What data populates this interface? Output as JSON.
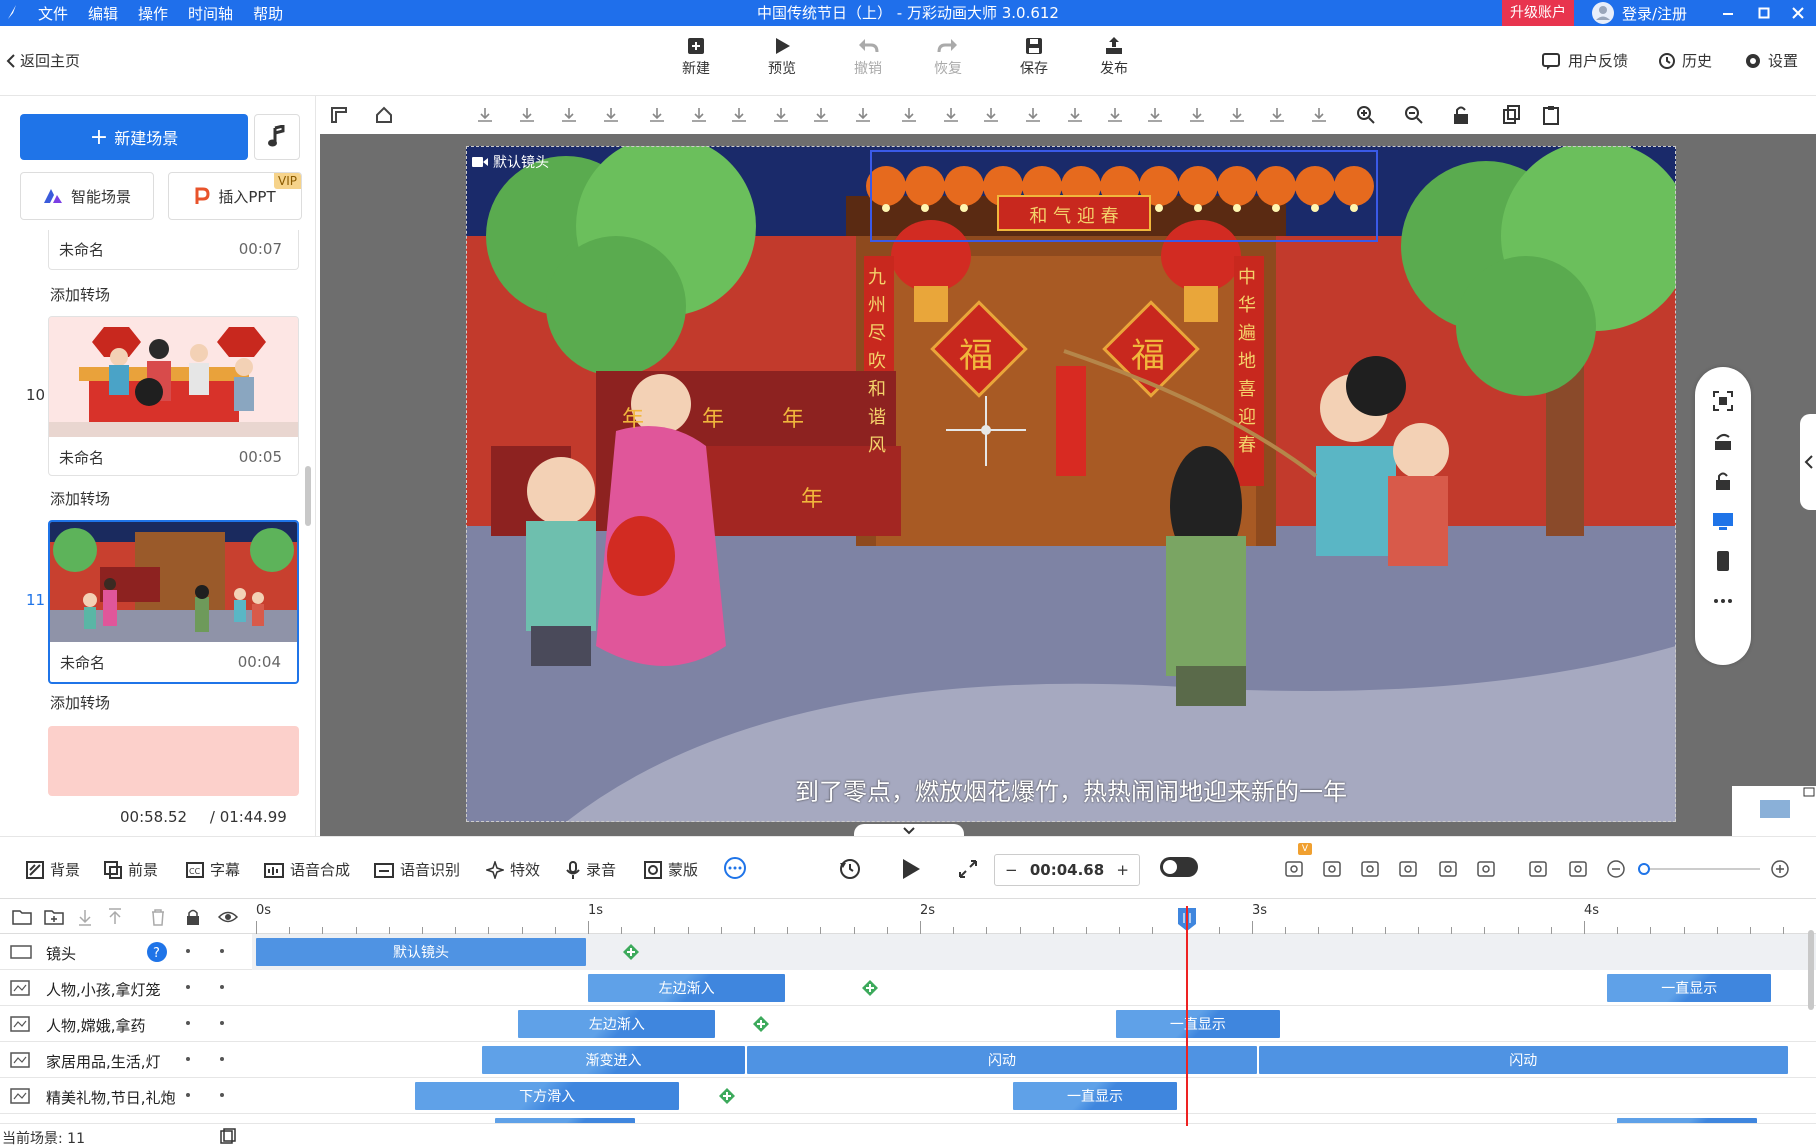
{
  "titlebar": {
    "menu": [
      "文件",
      "编辑",
      "操作",
      "时间轴",
      "帮助"
    ],
    "title": "中国传统节日（上） - 万彩动画大师 3.0.612",
    "upgrade": "升级账户",
    "login": "登录/注册",
    "color": "#1f6feb"
  },
  "toolbar": {
    "back": "返回主页",
    "buttons": [
      {
        "label": "新建",
        "icon": "plus-box-icon",
        "enabled": true
      },
      {
        "label": "预览",
        "icon": "play-icon",
        "enabled": true
      },
      {
        "label": "撤销",
        "icon": "undo-icon",
        "enabled": false
      },
      {
        "label": "恢复",
        "icon": "redo-icon",
        "enabled": false
      },
      {
        "label": "保存",
        "icon": "save-icon",
        "enabled": true
      },
      {
        "label": "发布",
        "icon": "publish-icon",
        "enabled": true
      }
    ],
    "right": {
      "feedback": "用户反馈",
      "history": "历史",
      "settings": "设置"
    }
  },
  "left": {
    "new_scene": "新建场景",
    "smart_scene": "智能场景",
    "insert_ppt": "插入PPT",
    "vip": "VIP",
    "scenes": [
      {
        "number": "",
        "name": "未命名",
        "time": "00:07",
        "selected": false
      },
      {
        "number": "10",
        "name": "未命名",
        "time": "00:05",
        "selected": false
      },
      {
        "number": "11",
        "name": "未命名",
        "time": "00:04",
        "selected": true
      }
    ],
    "add_transition": "添加转场",
    "current_time": "00:58.52",
    "total_time": "/ 01:44.99"
  },
  "canvas": {
    "camera_label": "默认镜头",
    "banner_text": "和 气 迎 春",
    "couplet_left": "九州尽吹和谐风",
    "couplet_right": "中华遍地喜迎春",
    "fu": "福",
    "nian": "年",
    "subtitle": "到了零点，燃放烟花爆竹，热热闹闹地迎来新的一年"
  },
  "timeline_tools": {
    "items": [
      "背景",
      "前景",
      "字幕",
      "语音合成",
      "语音识别",
      "特效",
      "录音",
      "蒙版"
    ],
    "current_time": "00:04.68",
    "badge": "V"
  },
  "timeline": {
    "ticks": [
      "0s",
      "1s",
      "2s",
      "3s",
      "4s"
    ],
    "rows": [
      {
        "name": "镜头",
        "type": "camera",
        "clips": [
          {
            "label": "默认镜头",
            "start": 0,
            "end": 1.0
          }
        ],
        "keyframes": [
          1.13
        ]
      },
      {
        "name": "人物,小孩,拿灯笼",
        "type": "object",
        "clips": [
          {
            "label": "左边渐入",
            "start": 1.0,
            "end": 1.6
          },
          {
            "label": "一直显示",
            "start": 4.07,
            "end": 4.57
          }
        ],
        "keyframes": [
          1.85
        ]
      },
      {
        "name": "人物,嫦娥,拿药",
        "type": "object",
        "clips": [
          {
            "label": "左边渐入",
            "start": 0.79,
            "end": 1.39
          },
          {
            "label": "一直显示",
            "start": 2.59,
            "end": 3.09
          }
        ],
        "keyframes": [
          1.52
        ]
      },
      {
        "name": "家居用品,生活,灯",
        "type": "object",
        "clips": [
          {
            "label": "渐变进入",
            "start": 0.68,
            "end": 1.48
          },
          {
            "label": "闪动",
            "start": 1.48,
            "end": 3.02
          },
          {
            "label": "闪动",
            "start": 3.02,
            "end": 4.62
          }
        ],
        "keyframes": []
      },
      {
        "name": "精美礼物,节日,礼炮",
        "type": "object",
        "clips": [
          {
            "label": "下方滑入",
            "start": 0.48,
            "end": 1.28
          },
          {
            "label": "一直显示",
            "start": 2.28,
            "end": 2.78
          }
        ],
        "keyframes": [
          1.42
        ]
      }
    ],
    "playhead": 2.8,
    "current_scene": "当前场景: 11"
  }
}
